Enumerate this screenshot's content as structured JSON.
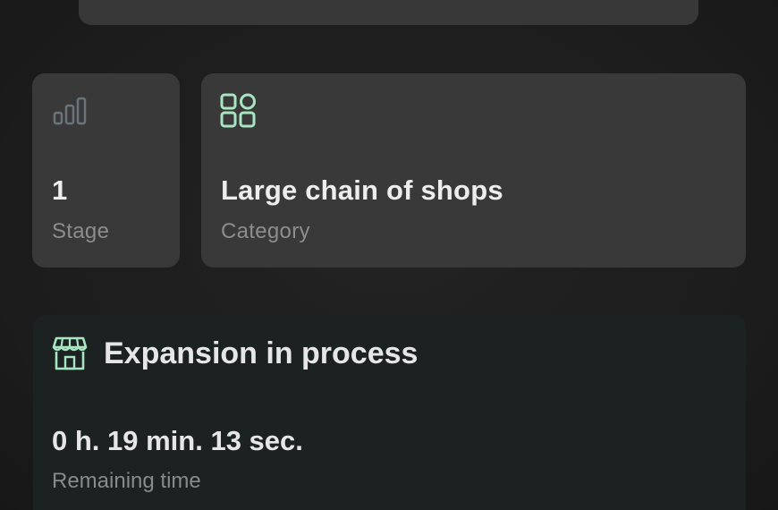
{
  "stage": {
    "value": "1",
    "label": "Stage",
    "icon": "signal-bars-icon"
  },
  "category": {
    "value": "Large chain of shops",
    "label": "Category",
    "icon": "grid-icon"
  },
  "expansion": {
    "title": "Expansion in process",
    "icon": "store-icon",
    "time": "0 h. 19 min. 13 sec.",
    "time_label": "Remaining time"
  },
  "colors": {
    "accent": "#a8e6c1",
    "icon_muted": "#6b7478",
    "card": "#393939",
    "expansion_card": "#1b2221"
  }
}
